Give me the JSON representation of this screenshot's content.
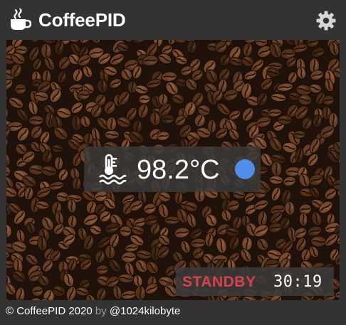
{
  "header": {
    "title": "CoffeePID",
    "logo_icon": "coffee-cup-icon",
    "settings_icon": "gear-icon"
  },
  "main": {
    "background": "coffee-beans-photo",
    "temperature": {
      "value": "98.2°C",
      "icon": "water-temperature-icon",
      "status_color": "#4f8ee8"
    },
    "status": {
      "label": "STANDBY",
      "label_color": "#d8414e",
      "timer": "30:19"
    }
  },
  "footer": {
    "copyright": "© CoffeePID 2020",
    "by": "by",
    "author": "@1024kilobyte"
  }
}
